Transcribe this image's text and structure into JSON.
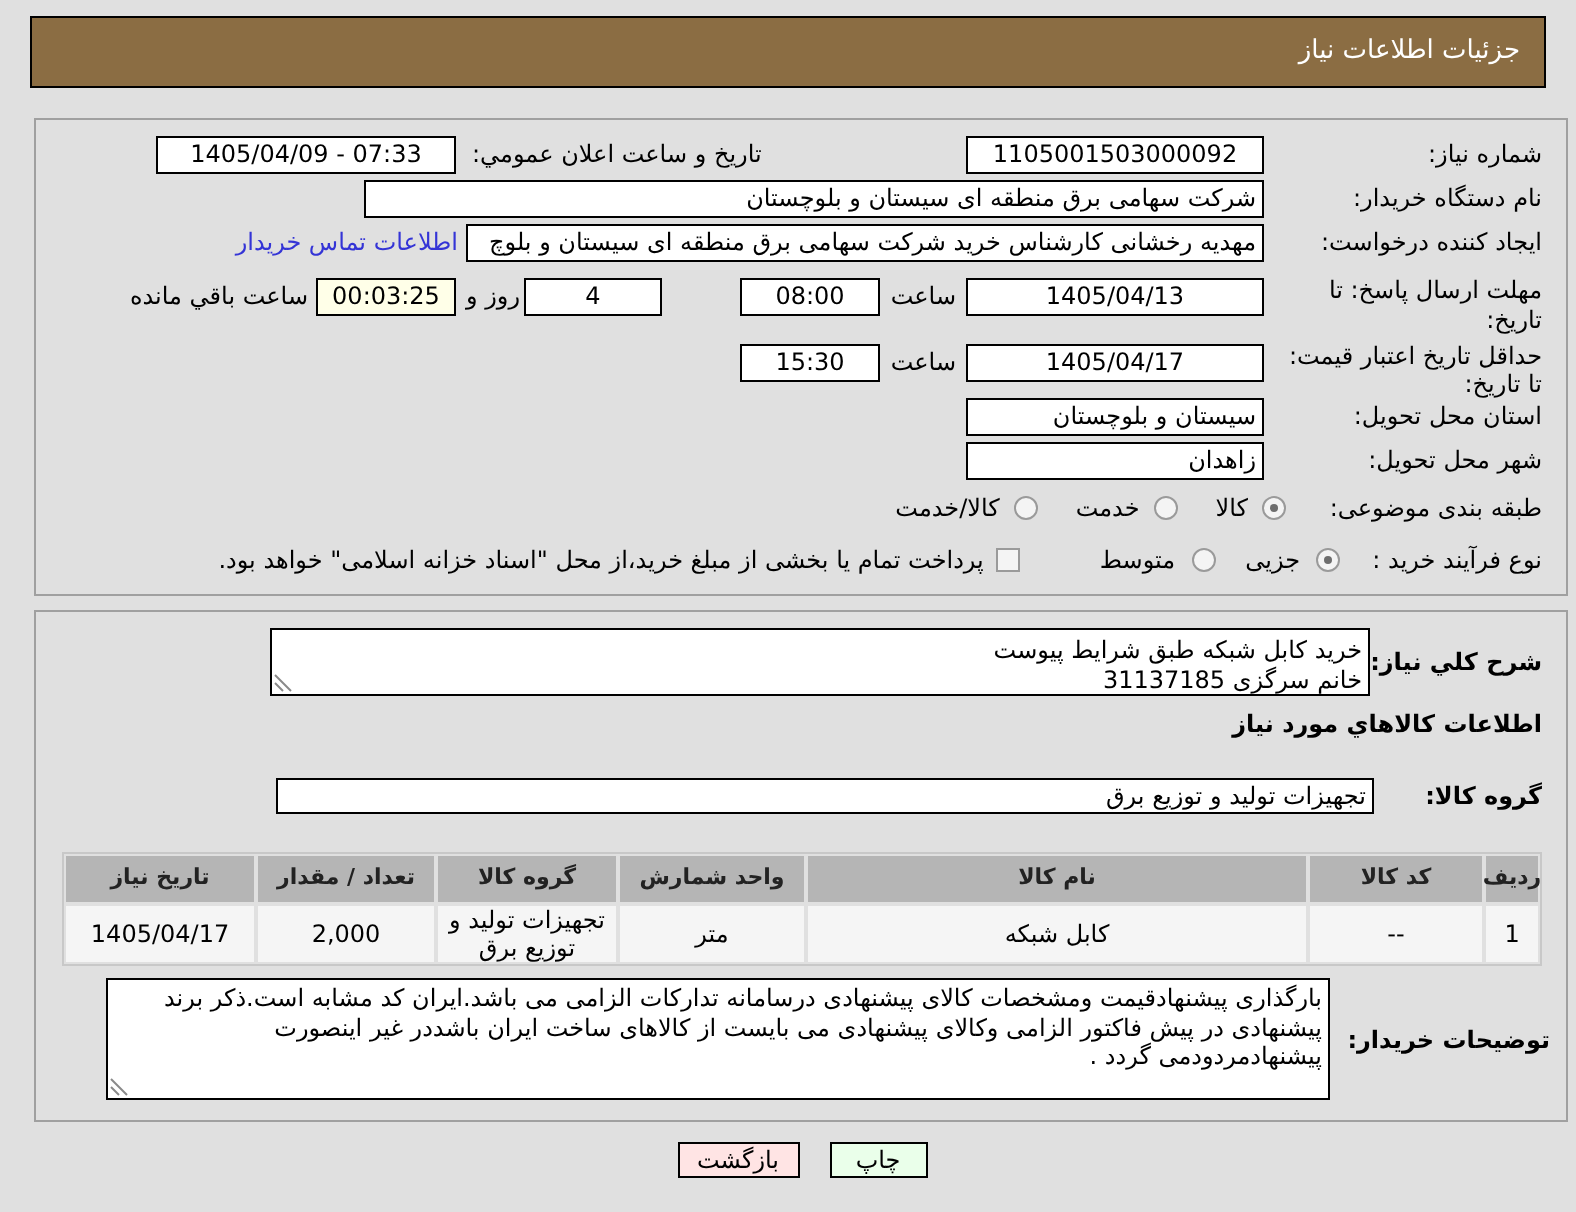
{
  "header": {
    "title": "جزئیات اطلاعات نیاز"
  },
  "details": {
    "need_number": {
      "label": "شماره نیاز:",
      "value": "1105001503000092"
    },
    "announcement": {
      "label": "تاریخ و ساعت اعلان عمومي:",
      "value": "1405/04/09 - 07:33"
    },
    "buyer_organization": {
      "label": "نام دستگاه خریدار:",
      "value": "شرکت سهامی برق منطقه ای سیستان و بلوچستان"
    },
    "requester": {
      "label": "ایجاد کننده درخواست:",
      "value": "مهدیه رخشانی کارشناس خرید شرکت سهامی برق منطقه ای سیستان و بلوچ",
      "contact_link": "اطلاعات تماس خریدار"
    },
    "response_deadline": {
      "label": "مهلت ارسال پاسخ: تا\nتاریخ:",
      "date": "1405/04/13",
      "time_label": "ساعت",
      "time": "08:00",
      "days": "4",
      "days_label": "روز و",
      "remaining_time": "00:03:25",
      "remaining_label": "ساعت باقي مانده"
    },
    "price_validity": {
      "label": "حداقل تاریخ اعتبار قیمت:\nتا تاریخ:",
      "date": "1405/04/17",
      "time_label": "ساعت",
      "time": "15:30"
    },
    "delivery_province": {
      "label": "استان محل تحویل:",
      "value": "سیستان و بلوچستان"
    },
    "delivery_city": {
      "label": "شهر محل تحویل:",
      "value": "زاهدان"
    },
    "subject_category": {
      "label": "طبقه بندی موضوعی:",
      "options": [
        {
          "label": "کالا",
          "selected": true
        },
        {
          "label": "خدمت",
          "selected": false
        },
        {
          "label": "کالا/خدمت",
          "selected": false
        }
      ]
    },
    "purchase_process": {
      "label": "نوع فرآیند خرید :",
      "options": [
        {
          "label": "جزیی",
          "selected": true
        },
        {
          "label": "متوسط",
          "selected": false
        }
      ],
      "treasury_payment": {
        "label": "پرداخت تمام یا بخشی از مبلغ خرید،از محل \"اسناد خزانه اسلامی\" خواهد بود.",
        "checked": false
      }
    }
  },
  "need_description": {
    "label": "شرح كلي نياز:",
    "value": "خرید کابل شبکه طبق شرایط پیوست\nخانم سرگزی 31137185"
  },
  "goods": {
    "title": "اطلاعات كالاهاي مورد نياز",
    "group": {
      "label": "گروه کالا:",
      "value": "تجهیزات تولید و توزیع برق"
    },
    "table": {
      "columns": [
        "ردیف",
        "کد کالا",
        "نام کالا",
        "واحد شمارش",
        "گروه کالا",
        "تعداد / مقدار",
        "تاریخ نیاز"
      ],
      "rows": [
        [
          "1",
          "--",
          "کابل شبکه",
          "متر",
          "تجهیزات تولید و توزیع برق",
          "2,000",
          "1405/04/17"
        ]
      ]
    }
  },
  "buyer_notes": {
    "label": "توضیحات خریدار:",
    "value": "بارگذاری پیشنهادقیمت ومشخصات کالای پیشنهادی درسامانه تدارکات الزامی می باشد.ایران کد مشابه است.ذکر برند پیشنهادی در پیش فاکتور الزامی وکالای پیشنهادی می بایست از کالاهای ساخت ایران باشددر غیر اینصورت پیشنهادمردودمی گردد ."
  },
  "buttons": [
    {
      "kind": "print",
      "label": "چاپ"
    },
    {
      "kind": "back",
      "label": "بازگشت"
    }
  ]
}
